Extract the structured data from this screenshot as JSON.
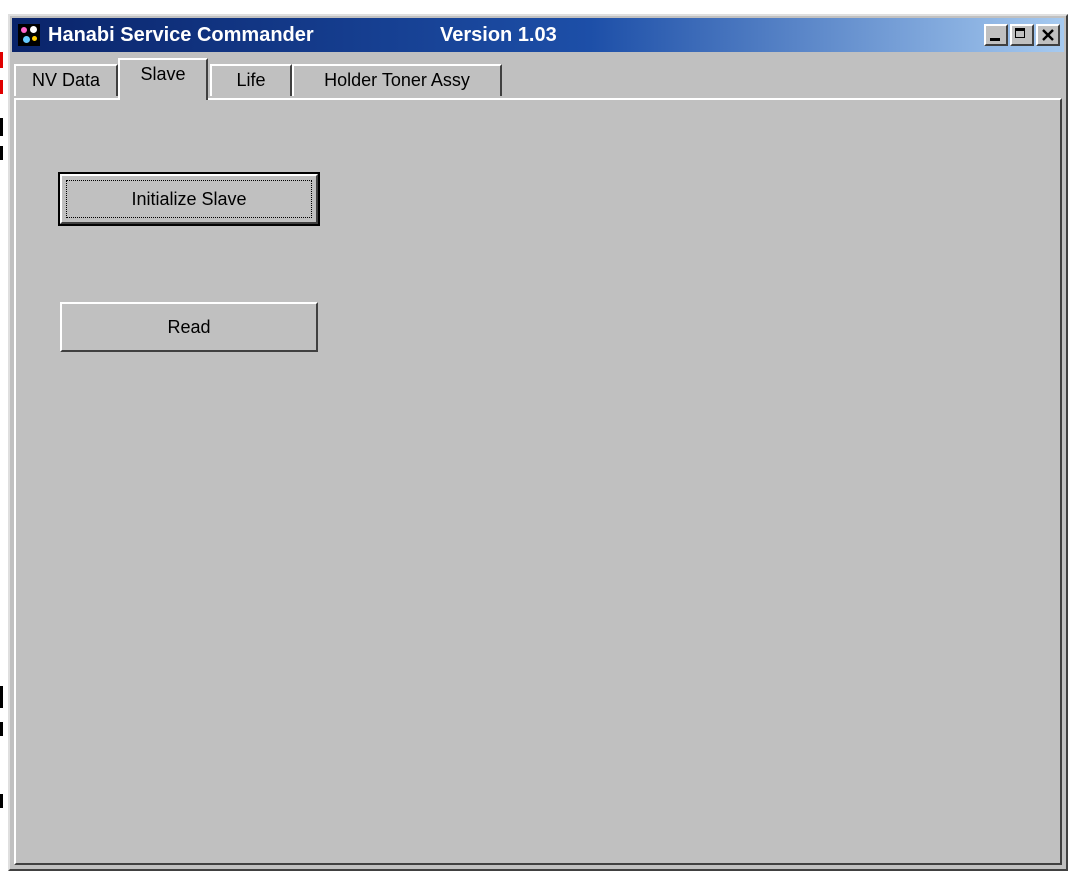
{
  "window": {
    "title": "Hanabi Service Commander",
    "version": "Version 1.03",
    "controls": {
      "minimize": "minimize-icon",
      "maximize": "maximize-icon",
      "close": "close-icon"
    },
    "colors": {
      "title_start": "#0a246a",
      "title_end": "#a6caf0",
      "face": "#c0c0c0"
    }
  },
  "tabs": [
    {
      "label": "NV Data",
      "active": false
    },
    {
      "label": "Slave",
      "active": true
    },
    {
      "label": "Life",
      "active": false
    },
    {
      "label": "Holder Toner Assy",
      "active": false
    }
  ],
  "panel": {
    "initialize_label": "Initialize Slave",
    "read_label": "Read"
  }
}
